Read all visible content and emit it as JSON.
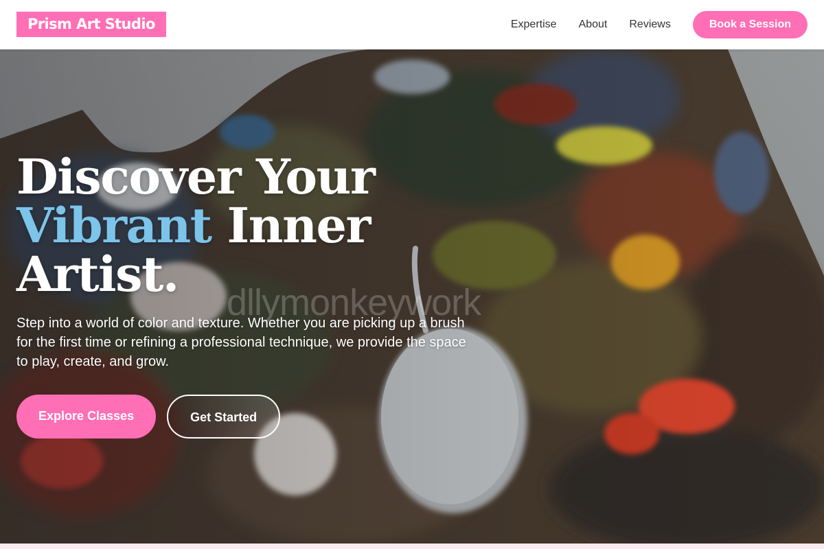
{
  "header": {
    "logo": "Prism Art Studio",
    "nav": [
      {
        "label": "Expertise"
      },
      {
        "label": "About"
      },
      {
        "label": "Reviews"
      }
    ],
    "cta_label": "Book a Session"
  },
  "hero": {
    "title_line1": "Discover Your",
    "title_accent": "Vibrant",
    "title_line2_rest": "Inner",
    "title_line3": "Artist.",
    "subtitle": "Step into a world of color and texture. Whether you are picking up a brush for the first time or refining a professional technique, we provide the space to play, create, and grow.",
    "primary_button": "Explore Classes",
    "secondary_button": "Get Started",
    "watermark": "dllymonkeywork",
    "image_subject": "paint palette with swirled acrylic paint and a palette knife"
  },
  "colors": {
    "brand_pink": "#ff6fb5",
    "accent_blue": "#7cc4ea",
    "nav_text": "#333333",
    "header_bg": "#ffffff"
  }
}
